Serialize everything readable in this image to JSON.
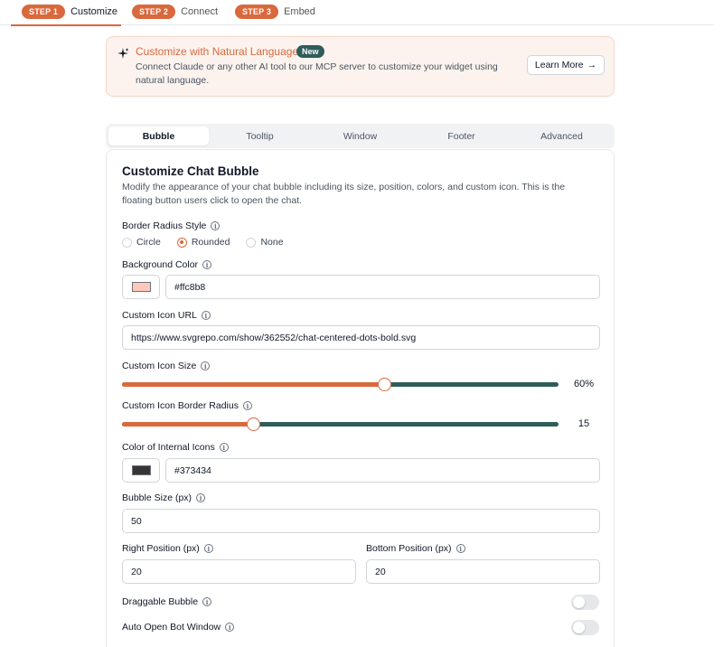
{
  "steps": [
    {
      "badge": "STEP 1",
      "label": "Customize"
    },
    {
      "badge": "STEP 2",
      "label": "Connect"
    },
    {
      "badge": "STEP 3",
      "label": "Embed"
    }
  ],
  "banner": {
    "title": "Customize with Natural Language",
    "badge": "New",
    "text": "Connect Claude or any other AI tool to our MCP server to customize your widget using natural language.",
    "button": "Learn More",
    "button_arrow": "→"
  },
  "tabs": [
    "Bubble",
    "Tooltip",
    "Window",
    "Footer",
    "Advanced"
  ],
  "card": {
    "title": "Customize Chat Bubble",
    "description": "Modify the appearance of your chat bubble including its size, position, colors, and custom icon. This is the floating button users click to open the chat.",
    "border_radius": {
      "label": "Border Radius Style",
      "options": [
        "Circle",
        "Rounded",
        "None"
      ],
      "selected": "Rounded"
    },
    "background_color": {
      "label": "Background Color",
      "value": "#ffc8b8",
      "swatch": "#ffc8b8"
    },
    "custom_icon_url": {
      "label": "Custom Icon URL",
      "value": "https://www.svgrepo.com/show/362552/chat-centered-dots-bold.svg"
    },
    "custom_icon_size": {
      "label": "Custom Icon Size",
      "value_text": "60%",
      "fraction": 0.6
    },
    "custom_icon_border_radius": {
      "label": "Custom Icon Border Radius",
      "value_text": "15",
      "fraction": 0.3
    },
    "internal_icons_color": {
      "label": "Color of Internal Icons",
      "value": "#373434",
      "swatch": "#373434"
    },
    "bubble_size": {
      "label": "Bubble Size (px)",
      "value": "50"
    },
    "right_position": {
      "label": "Right Position (px)",
      "value": "20"
    },
    "bottom_position": {
      "label": "Bottom Position (px)",
      "value": "20"
    },
    "draggable_bubble": {
      "label": "Draggable Bubble",
      "on": false
    },
    "auto_open": {
      "label": "Auto Open Bot Window",
      "on": false
    }
  },
  "colors": {
    "accent": "#d9683d",
    "teal": "#2e5d5a"
  },
  "icons": {
    "info": "i",
    "sparkle": "sparkle-icon"
  }
}
